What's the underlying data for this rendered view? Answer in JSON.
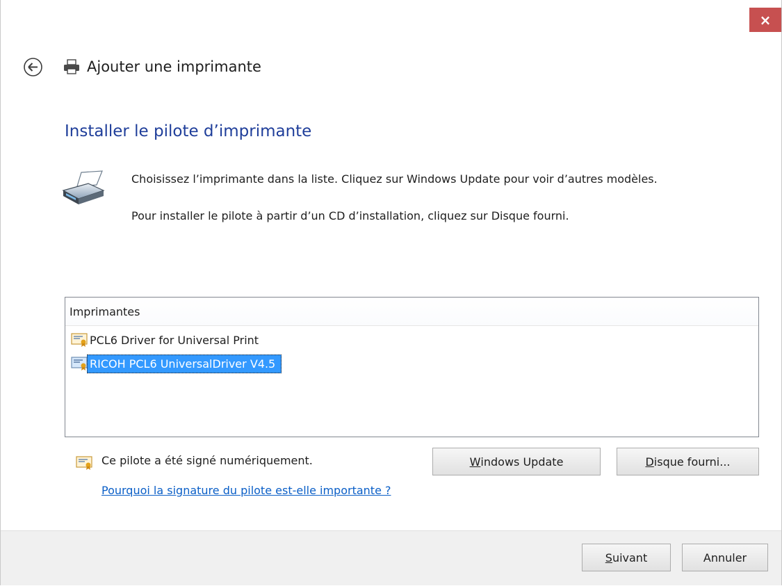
{
  "window": {
    "close_label": "×"
  },
  "header": {
    "title": "Ajouter une imprimante"
  },
  "main": {
    "section_title": "Installer le pilote d’imprimante",
    "instruction_1": "Choisissez l’imprimante dans la liste. Cliquez sur Windows Update pour voir d’autres modèles.",
    "instruction_2": "Pour installer le pilote à partir d’un CD d’installation, cliquez sur Disque fourni."
  },
  "printer_list": {
    "header": "Imprimantes",
    "items": [
      {
        "label": "PCL6 Driver for Universal Print",
        "selected": false
      },
      {
        "label": "RICOH PCL6 UniversalDriver V4.5",
        "selected": true
      }
    ]
  },
  "signature": {
    "status": "Ce pilote a été signé numériquement.",
    "link": "Pourquoi la signature du pilote est-elle importante ?"
  },
  "buttons": {
    "windows_update_mnemonic": "W",
    "windows_update_rest": "indows Update",
    "disk_mnemonic": "D",
    "disk_rest": "isque fourni...",
    "next_mnemonic": "S",
    "next_rest": "uivant",
    "cancel": "Annuler"
  },
  "colors": {
    "title_blue": "#1f3e9a",
    "link_blue": "#0b5fc7",
    "selection": "#3399ff",
    "close_red": "#c75050"
  },
  "icons": [
    "close-icon",
    "back-arrow-icon",
    "printer-icon",
    "certificate-icon"
  ]
}
